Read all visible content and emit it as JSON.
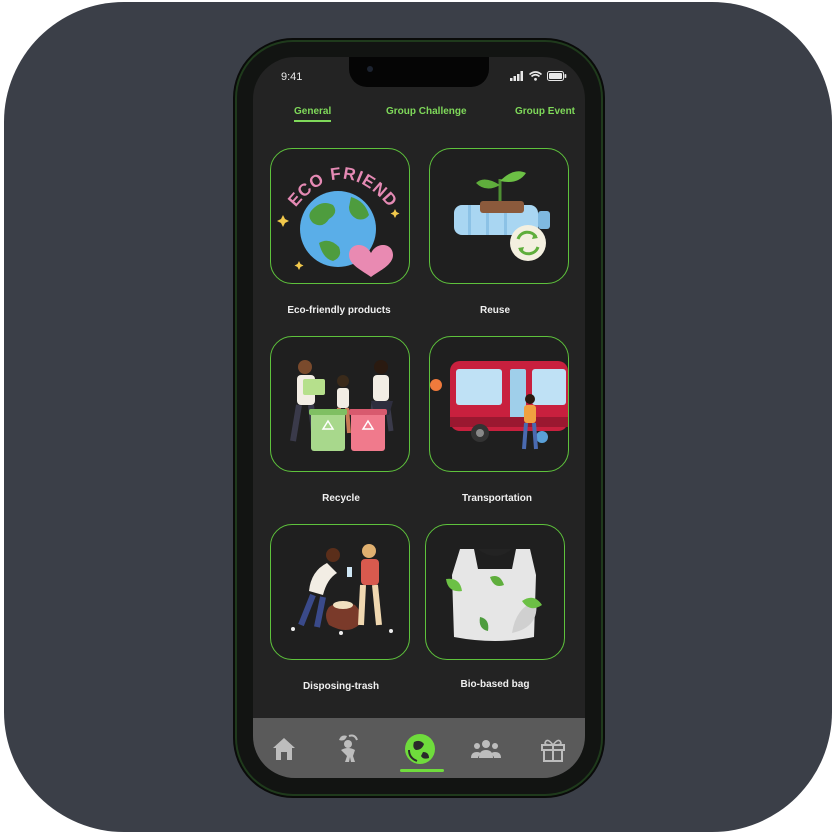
{
  "status": {
    "time": "9:41"
  },
  "tabs": [
    {
      "label": "General",
      "active": true
    },
    {
      "label": "Group Challenge",
      "active": false
    },
    {
      "label": "Group Event",
      "active": false
    }
  ],
  "categories": [
    {
      "label": "Eco-friendly products",
      "icon": "eco-friendly-earth-illustration",
      "badge_text": "ECO FRIENDLY"
    },
    {
      "label": "Reuse",
      "icon": "reuse-plant-bottle-illustration"
    },
    {
      "label": "Recycle",
      "icon": "recycle-people-bins-illustration"
    },
    {
      "label": "Transportation",
      "icon": "bus-transport-illustration"
    },
    {
      "label": "Disposing-trash",
      "icon": "people-cleaning-trash-illustration"
    },
    {
      "label": "Bio-based bag",
      "icon": "bio-bag-leaves-illustration"
    }
  ],
  "bottom_nav": [
    {
      "name": "home-icon",
      "active": false
    },
    {
      "name": "eco-person-icon",
      "active": false
    },
    {
      "name": "earth-recycle-icon",
      "active": true
    },
    {
      "name": "community-icon",
      "active": false
    },
    {
      "name": "gift-icon",
      "active": false
    }
  ],
  "colors": {
    "accent": "#7fd95a",
    "card_border": "#5ec23c",
    "screen_bg": "#232323",
    "bottom_bar": "#5a5a5a",
    "outer_bg": "#3b3f48"
  }
}
